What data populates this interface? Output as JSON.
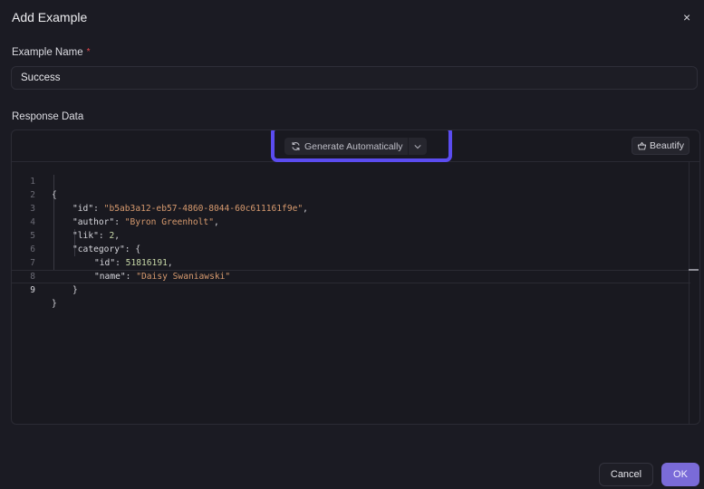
{
  "dialog": {
    "title": "Add Example",
    "close_label": "×"
  },
  "example_name": {
    "label": "Example Name",
    "required_mark": "*",
    "value": "Success"
  },
  "response_data": {
    "label": "Response Data",
    "generate_label": "Generate Automatically",
    "beautify_label": "Beautify",
    "line_numbers": [
      "1",
      "2",
      "3",
      "4",
      "5",
      "6",
      "7",
      "8",
      "9"
    ],
    "code": {
      "open_brace": "{",
      "id_key": "\"id\"",
      "id_value": "\"b5ab3a12-eb57-4860-8044-60c611161f9e\"",
      "author_key": "\"author\"",
      "author_value": "\"Byron Greenholt\"",
      "lik_key": "\"lik\"",
      "lik_value": "2",
      "category_key": "\"category\"",
      "cat_id_key": "\"id\"",
      "cat_id_value": "51816191",
      "cat_name_key": "\"name\"",
      "cat_name_value": "\"Daisy Swaniawski\"",
      "inner_close": "}",
      "close_brace": "}"
    }
  },
  "footer": {
    "cancel_label": "Cancel",
    "ok_label": "OK"
  },
  "colors": {
    "accent": "#7a6bd8",
    "highlight": "#5b4cf0",
    "string": "#d79a6e",
    "number": "#c7d8a8"
  }
}
